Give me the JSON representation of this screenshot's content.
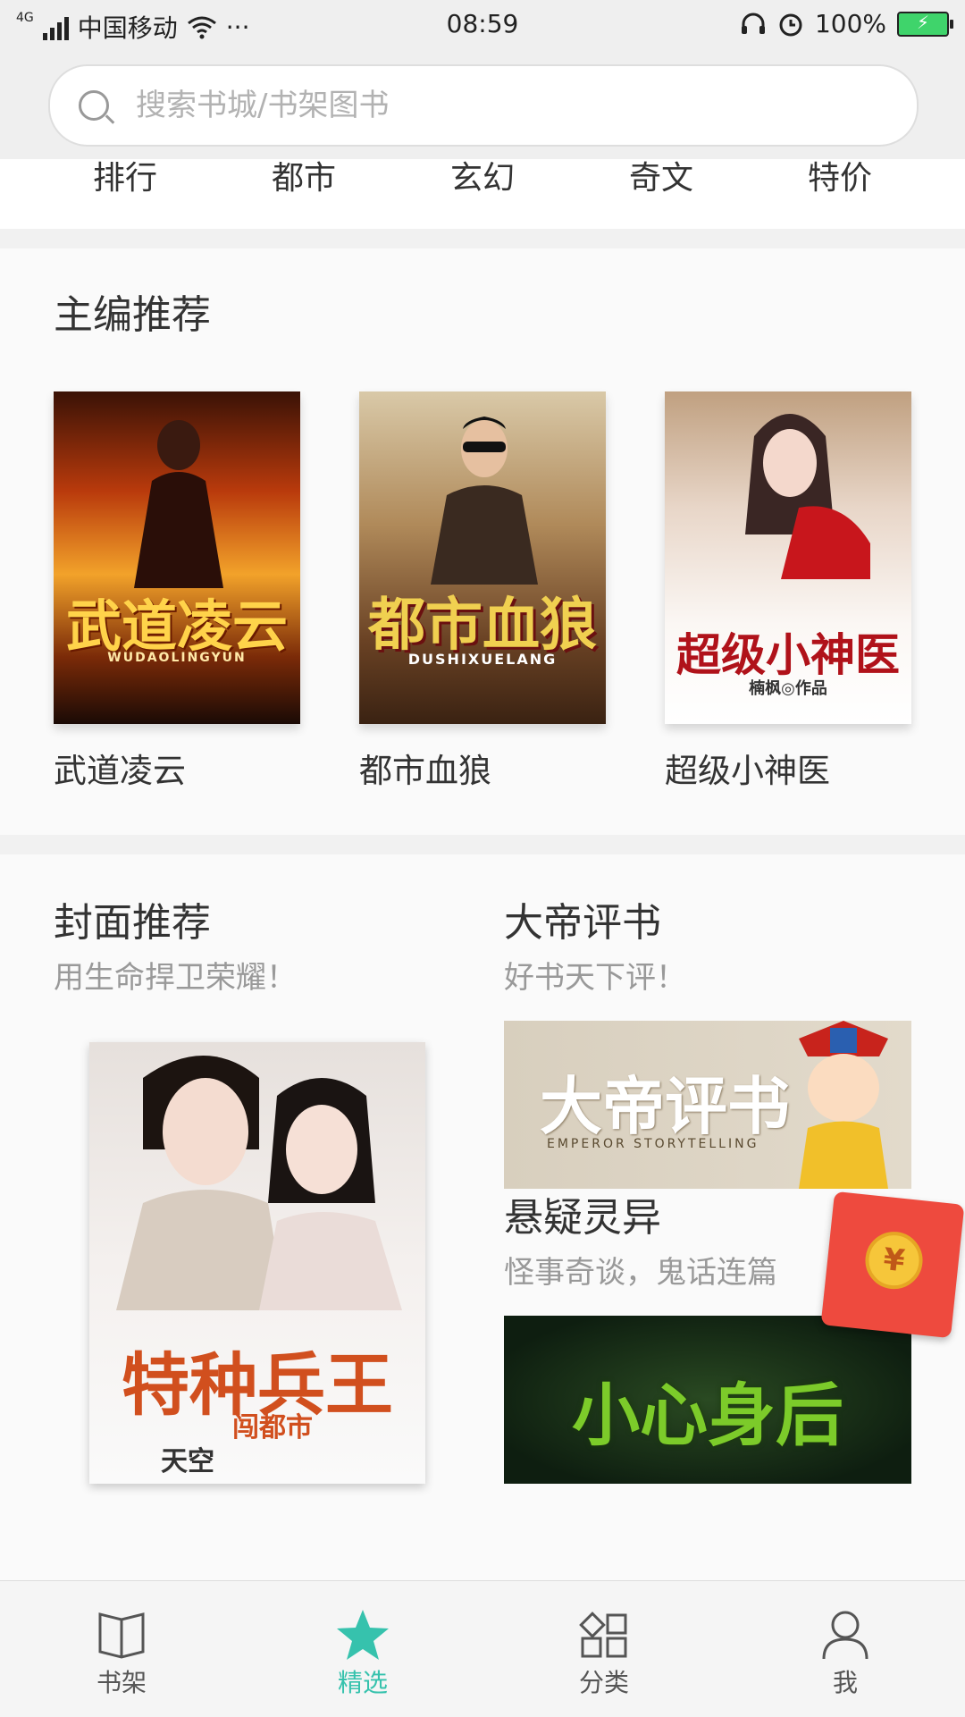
{
  "status": {
    "network": "4G",
    "carrier": "中国移动",
    "more": "···",
    "time": "08:59",
    "battery": "100%"
  },
  "search": {
    "placeholder": "搜索书城/书架图书"
  },
  "categories": [
    "排行",
    "都市",
    "玄幻",
    "奇文",
    "特价"
  ],
  "editor_picks": {
    "title": "主编推荐",
    "books": [
      {
        "name": "武道凌云",
        "cover_text": "武道凌云",
        "cover_sub": "WUDAOLINGYUN"
      },
      {
        "name": "都市血狼",
        "cover_text": "都市血狼",
        "cover_sub": "DUSHIXUELANG"
      },
      {
        "name": "超级小神医",
        "cover_text": "超级小神医",
        "cover_sub": "楠枫◎作品"
      }
    ]
  },
  "cover_rec": {
    "title": "封面推荐",
    "subtitle": "用生命捍卫荣耀！",
    "cover_text": "特种兵王",
    "cover_sub": "闯都市",
    "cover_author": "天空"
  },
  "dadi": {
    "title": "大帝评书",
    "subtitle": "好书天下评！",
    "banner_text": "大帝评书",
    "banner_sub": "EMPEROR STORYTELLING"
  },
  "mystery": {
    "title": "悬疑灵异",
    "subtitle": "怪事奇谈，鬼话连篇",
    "banner_text": "小心身后"
  },
  "redpack": {
    "symbol": "¥"
  },
  "tabs": [
    {
      "label": "书架",
      "icon": "book-open-icon"
    },
    {
      "label": "精选",
      "icon": "star-icon"
    },
    {
      "label": "分类",
      "icon": "category-icon"
    },
    {
      "label": "我",
      "icon": "user-icon"
    }
  ],
  "colors": {
    "accent": "#36c2ad",
    "redpack": "#ee4a3e"
  }
}
